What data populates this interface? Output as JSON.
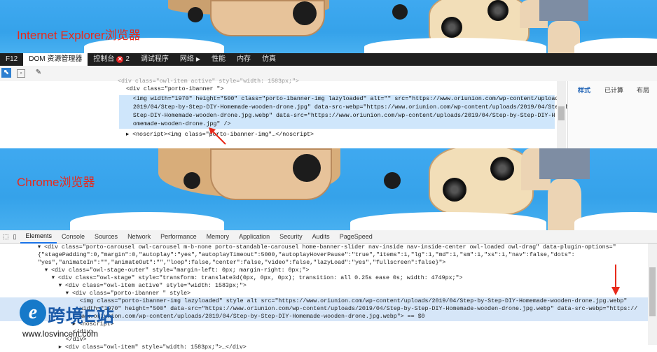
{
  "sections": {
    "ie_label": "Internet Explorer浏览器",
    "chrome_label": "Chrome浏览器"
  },
  "ie": {
    "tabs": [
      {
        "label": "F12"
      },
      {
        "label": "DOM 资源管理器"
      },
      {
        "label": "控制台",
        "badge": "2"
      },
      {
        "label": "调试程序"
      },
      {
        "label": "网络"
      },
      {
        "label": "性能"
      },
      {
        "label": "内存"
      },
      {
        "label": "仿真"
      }
    ],
    "side_tabs": [
      "样式",
      "已计算",
      "布局"
    ],
    "code_lines": [
      "  <div class=\"porto-ibanner \">",
      "    <img width=\"1970\" height=\"500\" class=\"porto-ibanner-img lazyloaded\" alt=\"\" src=\"https://www.oriunion.com/wp-content/uploads/",
      "    2019/04/Step-by-Step-DIY-Homemade-wooden-drone.jpg\" data-src-webp=\"https://www.oriunion.com/wp-content/uploads/2019/04/Step-by-",
      "    Step-DIY-Homemade-wooden-drone.jpg.webp\" data-src=\"https://www.oriunion.com/wp-content/uploads/2019/04/Step-by-Step-DIY-H",
      "    omemade-wooden-drone.jpg\" />",
      "  ▸ <noscript><img class=\"porto-ibanner-img\"…</noscript>"
    ]
  },
  "chrome": {
    "tabs": [
      "Elements",
      "Console",
      "Sources",
      "Network",
      "Performance",
      "Memory",
      "Application",
      "Security",
      "Audits",
      "PageSpeed"
    ],
    "code_lines": [
      "      ▾ <div class=\"porto-carousel owl-carousel m-b-none porto-standable-carousel home-banner-slider nav-inside nav-inside-center owl-loaded owl-drag\" data-plugin-options=\"",
      "      {\"stagePadding\":0,\"margin\":0,\"autoplay\":\"yes\",\"autoplayTimeout\":5000,\"autoplayHoverPause\":\"true\",\"items\":1,\"lg\":1,\"md\":1,\"sm\":1,\"xs\":1,\"nav\":false,\"dots\":",
      "      \"yes\",\"animateIn\":\"\",\"animateOut\":\"\",\"loop\":false,\"center\":false,\"video\":false,\"lazyLoad\":\"yes\",\"fullscreen\":false}\">",
      "        ▾ <div class=\"owl-stage-outer\" style=\"margin-left: 0px; margin-right: 0px;\">",
      "          ▾ <div class=\"owl-stage\" style=\"transform: translate3d(0px, 0px, 0px); transition: all 0.25s ease 0s; width: 4749px;\">",
      "            ▾ <div class=\"owl-item active\" style=\"width: 1583px;\">",
      "              ▾ <div class=\"porto-ibanner \" style>",
      "                  <img class=\"porto-ibanner-img lazyloaded\" style alt src=\"https://www.oriunion.com/wp-content/uploads/2019/04/Step-by-Step-DIY-Homemade-wooden-drone.jpg.webp\"",
      "                  width=\"1970\" height=\"500\" data-src=\"https://www.oriunion.com/wp-content/uploads/2019/04/Step-by-Step-DIY-Homemade-wooden-drone.jpg.webp\" data-src-webp=\"https://",
      "                  www.oriunion.com/wp-content/uploads/2019/04/Step-by-Step-DIY-Homemade-wooden-drone.jpg.webp\"> == $0",
      "                ▸ <noscript>",
      "                </div>",
      "              </div>",
      "            ▸ <div class=\"owl-item\" style=\"width: 1583px;\">…</div>"
    ]
  },
  "watermark": {
    "logo_letter": "e",
    "title": "跨境E站",
    "url": "www.losvincent.com"
  },
  "colors": {
    "label_red": "#e82a1b",
    "sky": "#3fa9f0",
    "ie_bar": "#1f1f1f",
    "arrow": "#e82a1b",
    "brand_blue": "#1c5aa8"
  }
}
